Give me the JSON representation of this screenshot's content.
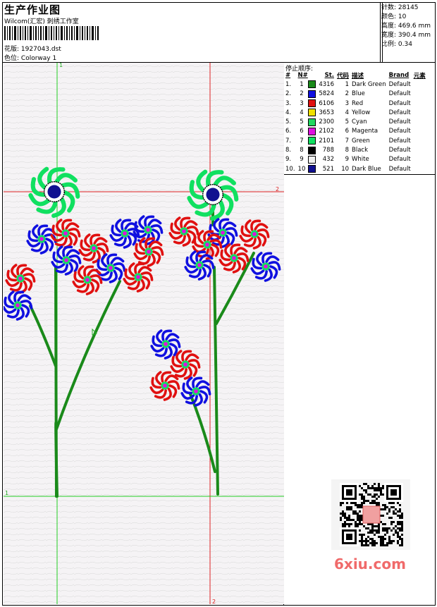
{
  "header": {
    "title": "生产作业图",
    "studio": "Wilcom(汇宏) 刺绣工作室",
    "design_label": "花版:",
    "design_value": "1927043.dst",
    "colorway_label": "色位:",
    "colorway_value": "Colorway 1"
  },
  "stats": {
    "stitches": "针数: 28145",
    "colors": "颜色: 10",
    "height": "高度: 469.6 mm",
    "width": "宽度: 390.4 mm",
    "scale": "比例: 0.34"
  },
  "stop_sequence": {
    "title": "停止顺序:",
    "headers": [
      "#",
      "N#",
      "St.",
      "代码",
      "描述",
      "Brand",
      "元素"
    ],
    "rows": [
      {
        "idx": "1.",
        "n": "1",
        "color": "#1a8a1a",
        "st": "4316",
        "code": "1",
        "desc": "Dark Green",
        "brand": "Default"
      },
      {
        "idx": "2.",
        "n": "2",
        "color": "#1010e0",
        "st": "5824",
        "code": "2",
        "desc": "Blue",
        "brand": "Default"
      },
      {
        "idx": "3.",
        "n": "3",
        "color": "#e01010",
        "st": "6106",
        "code": "3",
        "desc": "Red",
        "brand": "Default"
      },
      {
        "idx": "4.",
        "n": "4",
        "color": "#f0e000",
        "st": "3653",
        "code": "4",
        "desc": "Yellow",
        "brand": "Default"
      },
      {
        "idx": "5.",
        "n": "5",
        "color": "#20d860",
        "st": "2300",
        "code": "5",
        "desc": "Cyan",
        "brand": "Default"
      },
      {
        "idx": "6.",
        "n": "6",
        "color": "#e010e0",
        "st": "2102",
        "code": "6",
        "desc": "Magenta",
        "brand": "Default"
      },
      {
        "idx": "7.",
        "n": "7",
        "color": "#10e060",
        "st": "2101",
        "code": "7",
        "desc": "Green",
        "brand": "Default"
      },
      {
        "idx": "8.",
        "n": "8",
        "color": "#000000",
        "st": "788",
        "code": "8",
        "desc": "Black",
        "brand": "Default"
      },
      {
        "idx": "9.",
        "n": "9",
        "color": "#f0f0f0",
        "st": "432",
        "code": "9",
        "desc": "White",
        "brand": "Default"
      },
      {
        "idx": "10.",
        "n": "10",
        "color": "#101090",
        "st": "521",
        "code": "10",
        "desc": "Dark Blue",
        "brand": "Default"
      }
    ]
  },
  "guides": {
    "v1": "1",
    "v2": "2",
    "h1": "1",
    "h2": "2"
  },
  "watermark": "6xiu.com"
}
